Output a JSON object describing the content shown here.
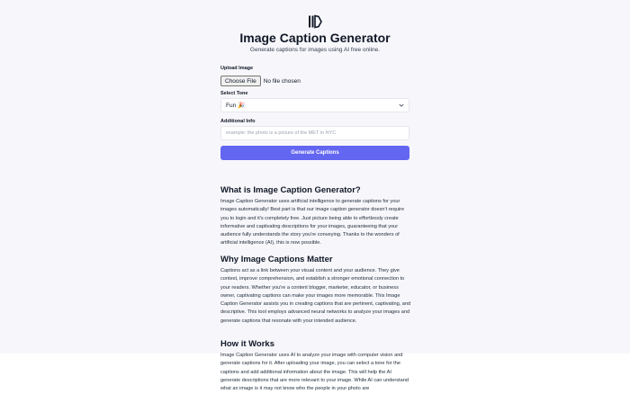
{
  "header": {
    "logo_icon": "book-columns-icon",
    "title": "Image Caption Generator",
    "subtitle": "Generate captions for images using AI free online."
  },
  "form": {
    "upload_label": "Upload Image",
    "choose_file_label": "Choose File",
    "file_status": "No file chosen",
    "tone_label": "Select Tone",
    "tone_value": "Fun 🎉",
    "info_label": "Additional Info",
    "info_placeholder": "example: the photo is a picture of the MET in NYC",
    "info_value": "",
    "generate_label": "Generate Captions"
  },
  "article": {
    "sections": [
      {
        "heading": "What is Image Caption Generator?",
        "body": "Image Caption Generator uses artificial intelligence to generate captions for your images automatically! Best part is that our image caption generator doesn't require you to login and it's completely free. Just picture being able to effortlessly create informative and captivating descriptions for your images, guaranteeing that your audience fully understands the story you're conveying. Thanks to the wonders of artificial intelligence (AI), this is now possible."
      },
      {
        "heading": "Why Image Captions Matter",
        "body": "Captions act as a link between your visual content and your audience. They give context, improve comprehension, and establish a stronger emotional connection to your readers. Whether you're a content blogger, marketer, educator, or business owner, captivating captions can make your images more memorable. This Image Caption Generator assists you in creating captions that are pertinent, captivating, and descriptive. This tool employs advanced neural networks to analyze your images and generate captions that resonate with your intended audience."
      },
      {
        "heading": "How it Works",
        "body": "Image Caption Generator uses AI to analyze your image with computer vision and generate captions for it. After uploading your image, you can select a tone for the captions and add additional information about the image. This will help the AI generate descriptions that are more relevant to your image. While AI can understand what an image is it may not know who the people in your photo are"
      }
    ]
  }
}
